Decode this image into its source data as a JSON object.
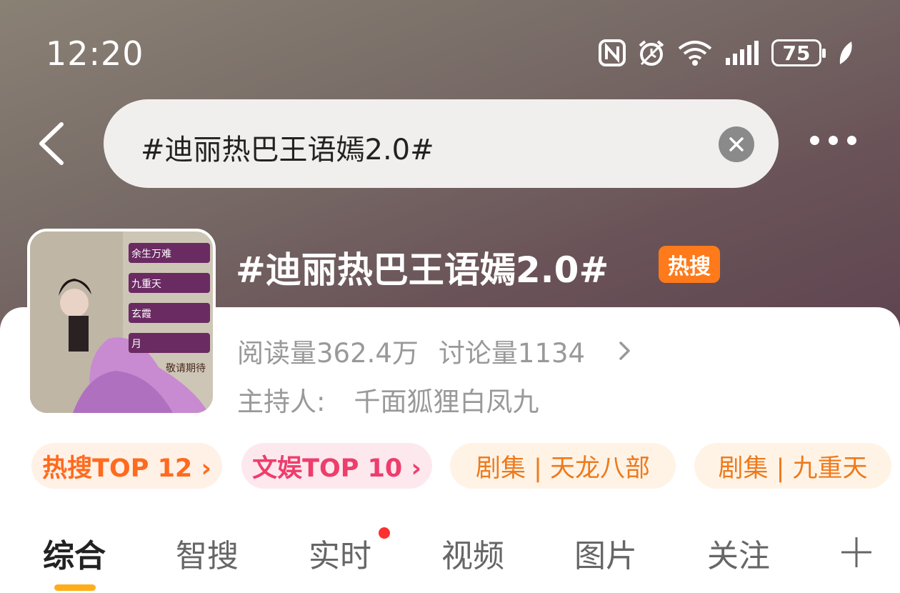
{
  "status_bar": {
    "time": "12:20",
    "battery": "75",
    "icons": [
      "nfc-icon",
      "alarm-icon",
      "wifi-icon",
      "signal-icon",
      "battery-icon",
      "leaf-icon"
    ]
  },
  "search": {
    "query": "#迪丽热巴王语嫣2.0#"
  },
  "topic": {
    "title": "#迪丽热巴王语嫣2.0#",
    "badge": "热搜",
    "reads": "阅读量362.4万",
    "discussions": "讨论量1134",
    "host_label": "主持人:",
    "host_name": "千面狐狸白凤九",
    "cover_texts": [
      "余生万难",
      "九重天",
      "玄霞",
      "月",
      "敬请期待"
    ]
  },
  "chips": [
    {
      "label": "热搜TOP 12 ›",
      "color": "#ff6a1f"
    },
    {
      "label": "文娱TOP 10 ›",
      "color": "#ee3d6c"
    },
    {
      "label": "剧集 | 天龙八部",
      "color": "#ee7a1c"
    },
    {
      "label": "剧集 | 九重天",
      "color": "#ee7a1c"
    }
  ],
  "tabs": [
    "综合",
    "智搜",
    "实时",
    "视频",
    "图片",
    "关注"
  ],
  "colors": {
    "accent": "#ffae1a",
    "hot_badge": "#ff7a1a",
    "notification_dot": "#ff3030"
  }
}
